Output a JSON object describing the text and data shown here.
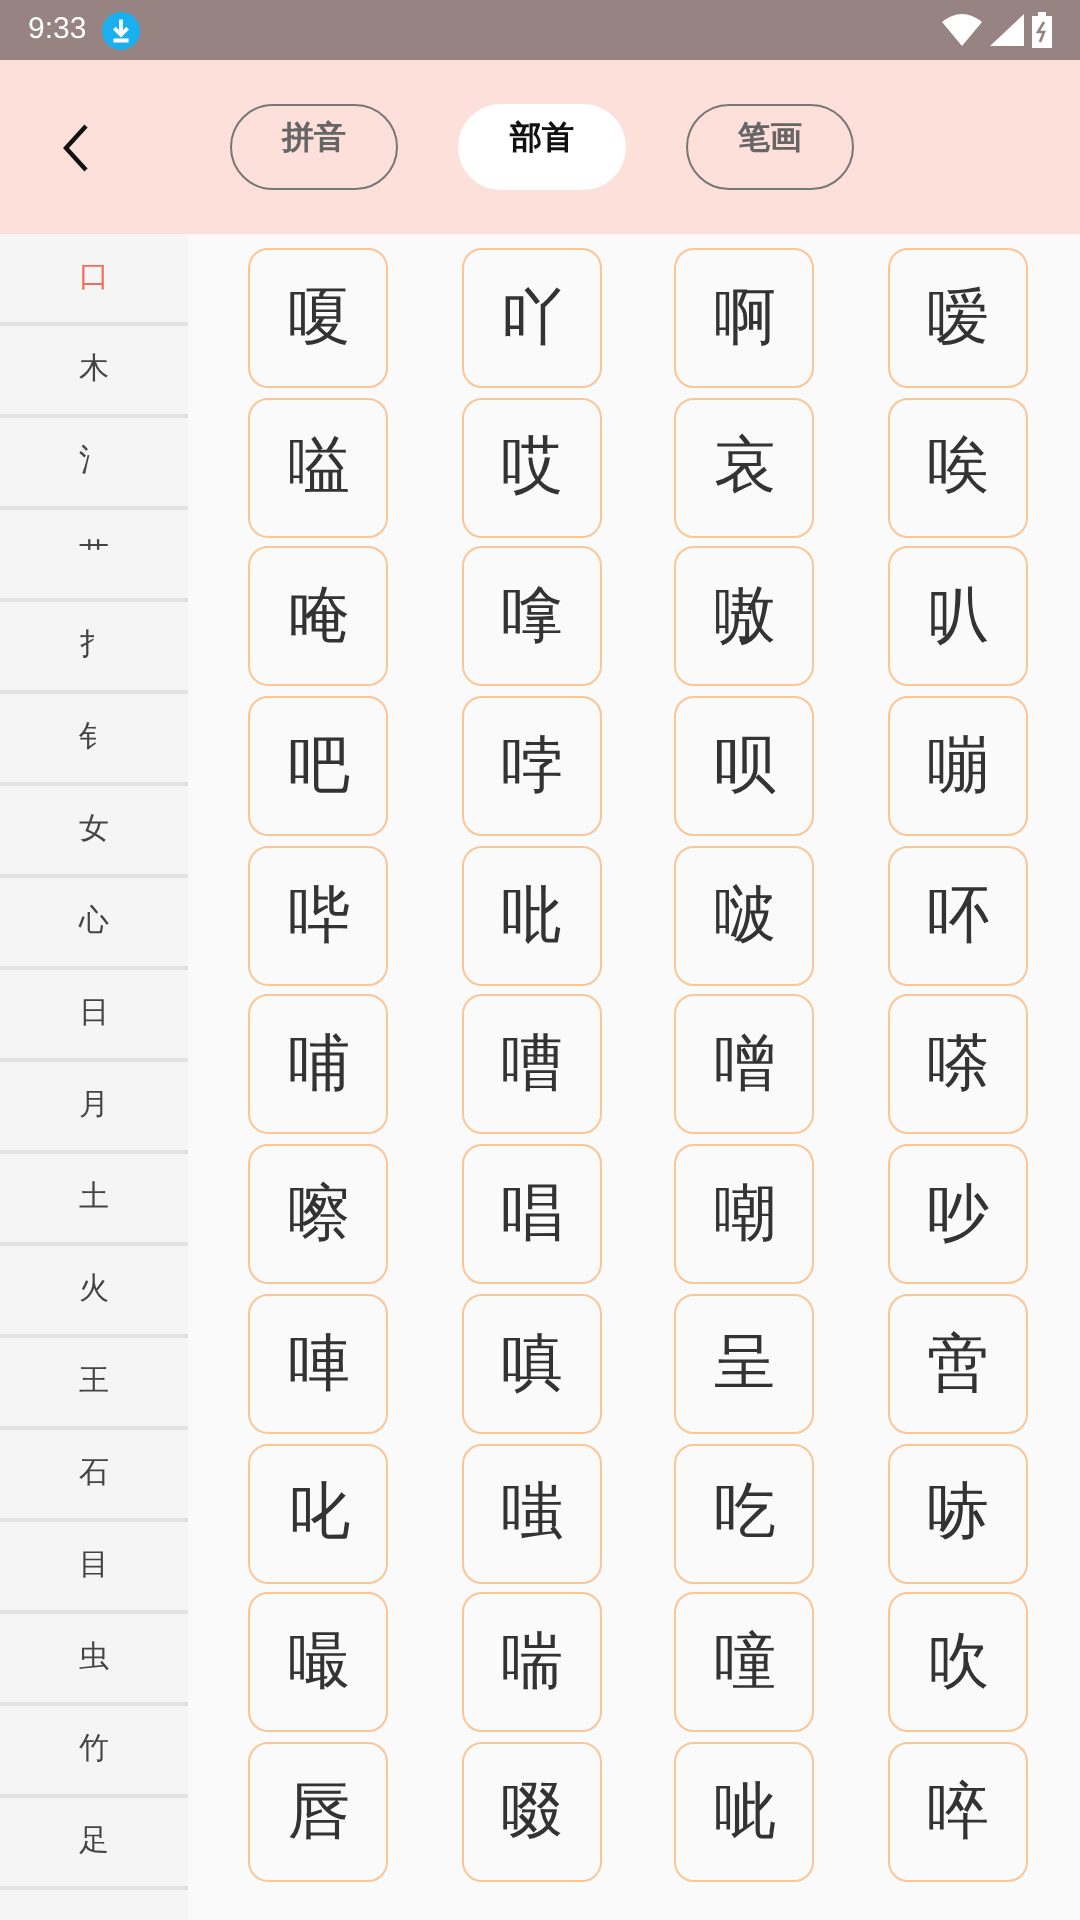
{
  "status_bar": {
    "time": "9:33"
  },
  "tabs": [
    {
      "label": "拼音",
      "selected": false
    },
    {
      "label": "部首",
      "selected": true
    },
    {
      "label": "笔画",
      "selected": false
    }
  ],
  "radicals": [
    {
      "label": "口",
      "selected": true
    },
    {
      "label": "木",
      "selected": false
    },
    {
      "label": "氵",
      "selected": false
    },
    {
      "label": "艹",
      "selected": false
    },
    {
      "label": "扌",
      "selected": false
    },
    {
      "label": "钅",
      "selected": false
    },
    {
      "label": "女",
      "selected": false
    },
    {
      "label": "心",
      "selected": false
    },
    {
      "label": "日",
      "selected": false
    },
    {
      "label": "月",
      "selected": false
    },
    {
      "label": "土",
      "selected": false
    },
    {
      "label": "火",
      "selected": false
    },
    {
      "label": "王",
      "selected": false
    },
    {
      "label": "石",
      "selected": false
    },
    {
      "label": "目",
      "selected": false
    },
    {
      "label": "虫",
      "selected": false
    },
    {
      "label": "竹",
      "selected": false
    },
    {
      "label": "足",
      "selected": false
    }
  ],
  "characters": [
    "嗄",
    "吖",
    "啊",
    "嗳",
    "嗌",
    "哎",
    "哀",
    "唉",
    "唵",
    "嗱",
    "嗷",
    "叭",
    "吧",
    "哱",
    "呗",
    "嘣",
    "哔",
    "吡",
    "啵",
    "吥",
    "哺",
    "嘈",
    "噌",
    "嗏",
    "嚓",
    "唱",
    "嘲",
    "吵",
    "唓",
    "嗔",
    "呈",
    "啻",
    "叱",
    "嗤",
    "吃",
    "哧",
    "嘬",
    "喘",
    "噇",
    "吹",
    "唇",
    "啜",
    "呲",
    "啐"
  ]
}
